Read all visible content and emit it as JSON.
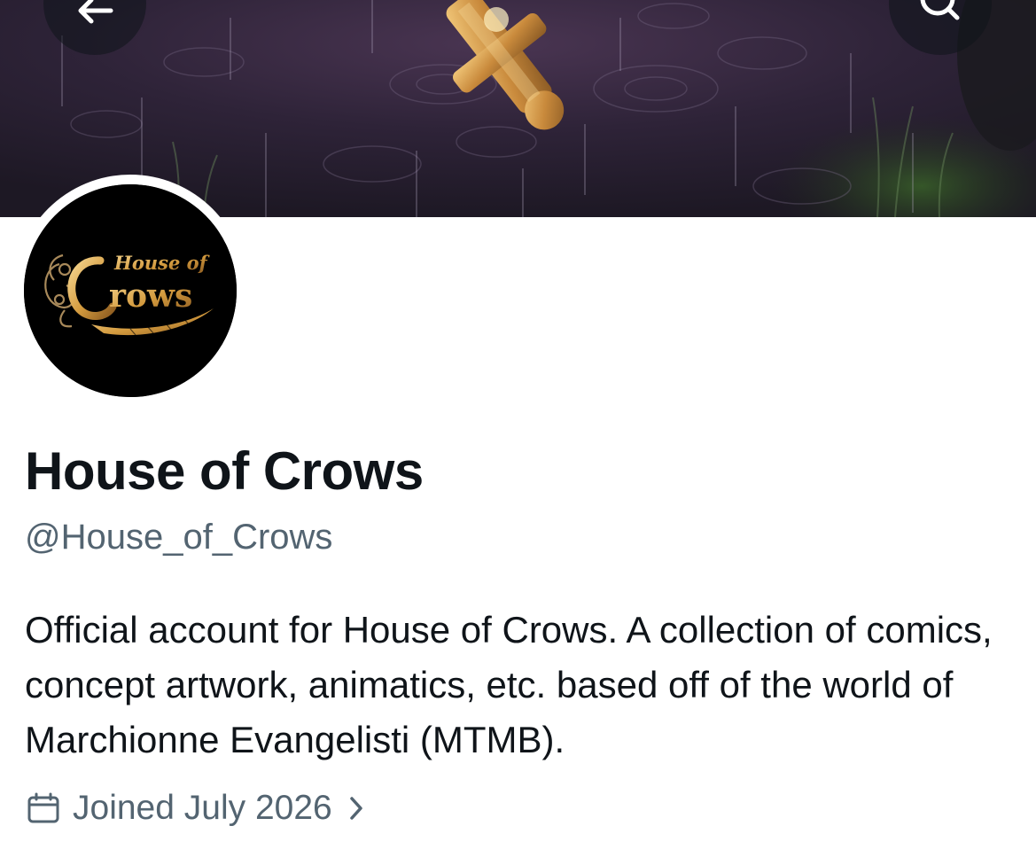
{
  "colors": {
    "primary_text": "#0f1419",
    "secondary_text": "#536471",
    "banner_base": "#2b2036",
    "banner_accent": "#c8913a",
    "avatar_gold": "#d9a443",
    "nav_button_bg": "#0f1419"
  },
  "header": {
    "back_icon": "arrow-left-icon",
    "search_icon": "search-icon"
  },
  "profile": {
    "avatar_logo_text": "House of Crows",
    "display_name": "House of Crows",
    "handle": "@House_of_Crows",
    "bio": "Official account for House of Crows. A collection of comics, concept artwork, animatics, etc. based off of the world of Marchionne Evangelisti (MTMB).",
    "joined": {
      "icon": "calendar-icon",
      "label": "Joined July 2026",
      "chevron_icon": "chevron-right-icon"
    }
  }
}
